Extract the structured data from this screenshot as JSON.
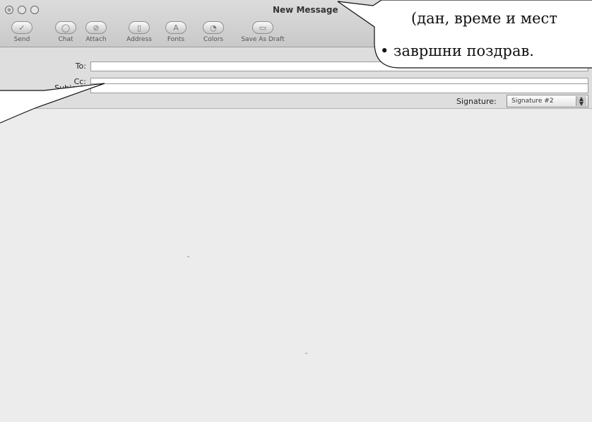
{
  "window": {
    "title": "New Message"
  },
  "toolbar": {
    "items": [
      {
        "label": "Send",
        "icon": "send-icon",
        "glyph": "✓"
      },
      {
        "label": "Chat",
        "icon": "chat-icon",
        "glyph": "◯"
      },
      {
        "label": "Attach",
        "icon": "paperclip-icon",
        "glyph": "⊘"
      },
      {
        "label": "Address",
        "icon": "address-book-icon",
        "glyph": "▯"
      },
      {
        "label": "Fonts",
        "icon": "fonts-icon",
        "glyph": "A"
      },
      {
        "label": "Colors",
        "icon": "color-wheel-icon",
        "glyph": "◔"
      },
      {
        "label": "Save As Draft",
        "icon": "draft-icon",
        "glyph": "▭"
      }
    ]
  },
  "header": {
    "to_label": "To:",
    "to_value": "",
    "cc_label": "Cc:",
    "cc_value": "",
    "subject_label": "Subject:",
    "subject_value": "",
    "signature_label": "Signature:",
    "signature_value": "Signature #2"
  },
  "callout": {
    "line1": "(дан, време и мест",
    "line2": "• завршни поздрав."
  }
}
